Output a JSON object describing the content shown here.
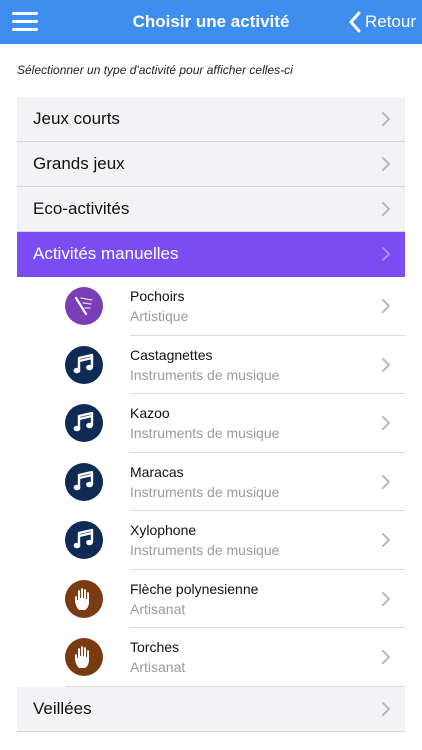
{
  "navbar": {
    "title": "Choisir une activité",
    "back_label": "Retour"
  },
  "instruction": "Sélectionner un type d'activité pour afficher celles-ci",
  "categories": [
    {
      "label": "Jeux courts"
    },
    {
      "label": "Grands jeux"
    },
    {
      "label": "Eco-activités"
    },
    {
      "label": "Activités manuelles"
    },
    {
      "label": "Veillées"
    }
  ],
  "activities": [
    {
      "name": "Pochoirs",
      "category": "Artistique",
      "icon": "brush-icon",
      "color": "#7a3fb6"
    },
    {
      "name": "Castagnettes",
      "category": "Instruments de musique",
      "icon": "music-note-icon",
      "color": "#0e2a55"
    },
    {
      "name": "Kazoo",
      "category": "Instruments de musique",
      "icon": "music-note-icon",
      "color": "#0e2a55"
    },
    {
      "name": "Maracas",
      "category": "Instruments de musique",
      "icon": "music-note-icon",
      "color": "#0e2a55"
    },
    {
      "name": "Xylophone",
      "category": "Instruments de musique",
      "icon": "music-note-icon",
      "color": "#0e2a55"
    },
    {
      "name": "Flèche polynesienne",
      "category": "Artisanat",
      "icon": "hand-icon",
      "color": "#7a3a12"
    },
    {
      "name": "Torches",
      "category": "Artisanat",
      "icon": "hand-icon",
      "color": "#7a3a12"
    }
  ],
  "colors": {
    "navbar": "#3e8ef0",
    "active_category": "#7a4cf2"
  }
}
